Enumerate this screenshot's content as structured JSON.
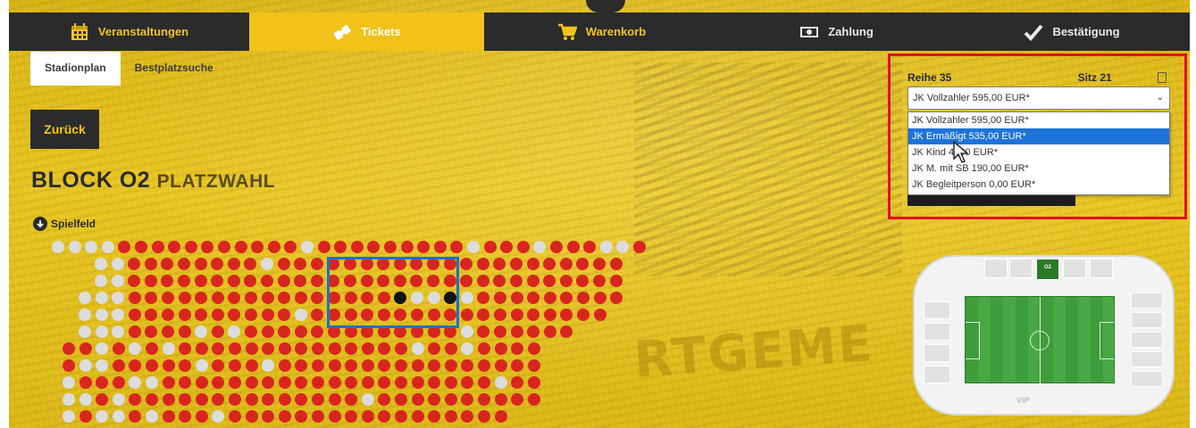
{
  "nav": {
    "items": [
      {
        "label": "Veranstaltungen",
        "icon": "calendar-icon",
        "active": false
      },
      {
        "label": "Tickets",
        "icon": "ticket-icon",
        "active": true
      },
      {
        "label": "Warenkorb",
        "icon": "cart-icon",
        "active": false
      },
      {
        "label": "Zahlung",
        "icon": "money-icon",
        "active": false
      },
      {
        "label": "Bestätigung",
        "icon": "check-icon",
        "active": false
      }
    ]
  },
  "tabs": {
    "stadionplan": "Stadionplan",
    "bestplatzsuche": "Bestplatzsuche"
  },
  "back_button": "Zurück",
  "block": {
    "name": "BLOCK O2",
    "subtitle": "PLATZWAHL"
  },
  "field_label": "Spielfeld",
  "seat_selection": {
    "row": "Reihe 35",
    "seat": "Sitz 21",
    "selected": "JK Vollzahler 595,00 EUR*",
    "options": [
      "JK Vollzahler 595,00 EUR*",
      "JK Ermäßigt 535,00 EUR*",
      "JK Kind 4  ,00 EUR*",
      "JK M. mit SB 190,00 EUR*",
      "JK Begleitperson 0,00 EUR*"
    ],
    "highlighted_index": 1
  },
  "stadium": {
    "selected_block": "O2",
    "vip_label": "VIP"
  },
  "colors": {
    "nav_bg": "#2b2b2b",
    "accent_yellow": "#f1c21a",
    "seat_taken": "#d8261e",
    "seat_free": "#dcdcdc",
    "seat_selected": "#111111",
    "highlight_box": "#1a73c7",
    "annotation_frame": "#e0121b"
  }
}
